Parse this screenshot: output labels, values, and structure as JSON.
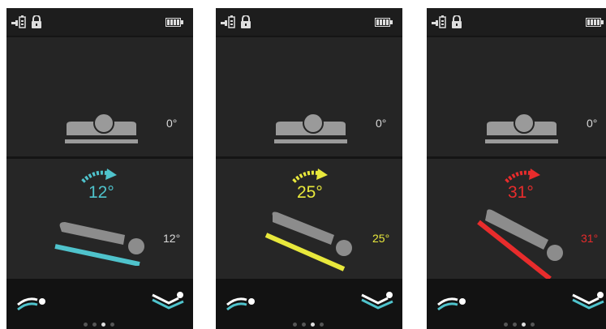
{
  "screens": [
    {
      "accent": "#4fc3cc",
      "reference_angle": "0°",
      "tilt_angle": "12°",
      "tilt_label": "12°",
      "tilt_level": 12,
      "page_dots": {
        "count": 4,
        "active": 2
      },
      "icons": [
        "plug-battery-icon",
        "lock-icon",
        "battery-icon",
        "arrow-icon",
        "flat-bed-icon",
        "tilted-bed-icon"
      ]
    },
    {
      "accent": "#e8e83c",
      "reference_angle": "0°",
      "tilt_angle": "25°",
      "tilt_label": "25°",
      "tilt_level": 25,
      "page_dots": {
        "count": 4,
        "active": 2
      },
      "icons": [
        "plug-battery-icon",
        "lock-icon",
        "battery-icon",
        "arrow-icon",
        "flat-bed-icon",
        "tilted-bed-icon"
      ]
    },
    {
      "accent": "#e82c2c",
      "reference_angle": "0°",
      "tilt_angle": "31°",
      "tilt_label": "31°",
      "tilt_level": 31,
      "page_dots": {
        "count": 4,
        "active": 2
      },
      "icons": [
        "plug-battery-icon",
        "lock-icon",
        "battery-icon",
        "arrow-icon",
        "flat-bed-icon",
        "tilted-bed-icon"
      ]
    }
  ]
}
